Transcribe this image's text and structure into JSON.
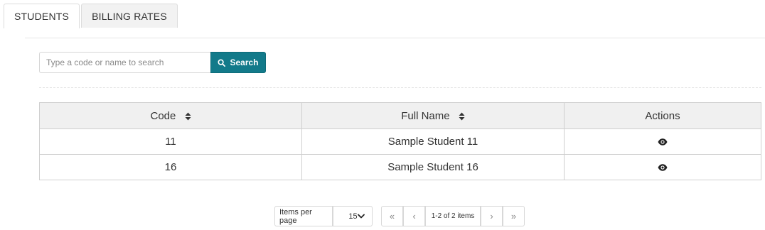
{
  "tabs": [
    {
      "label": "STUDENTS",
      "active": true
    },
    {
      "label": "BILLING RATES",
      "active": false
    }
  ],
  "search": {
    "placeholder": "Type a code or name to search",
    "value": "",
    "button_label": "Search",
    "button_icon": "search-icon"
  },
  "table": {
    "columns": [
      {
        "label": "Code",
        "sortable": true
      },
      {
        "label": "Full Name",
        "sortable": true
      },
      {
        "label": "Actions",
        "sortable": false
      }
    ],
    "rows": [
      {
        "code": "11",
        "full_name": "Sample Student 11",
        "action_icon": "eye-icon"
      },
      {
        "code": "16",
        "full_name": "Sample Student 16",
        "action_icon": "eye-icon"
      }
    ]
  },
  "pager": {
    "items_per_page_label": "Items per page",
    "items_per_page_value": "15",
    "first_label": "«",
    "prev_label": "‹",
    "page_info": "1-2 of 2 items",
    "next_label": "›",
    "last_label": "»"
  },
  "colors": {
    "accent": "#127a8a",
    "header_bg": "#f0f0f0",
    "border": "#cfcfcf"
  }
}
